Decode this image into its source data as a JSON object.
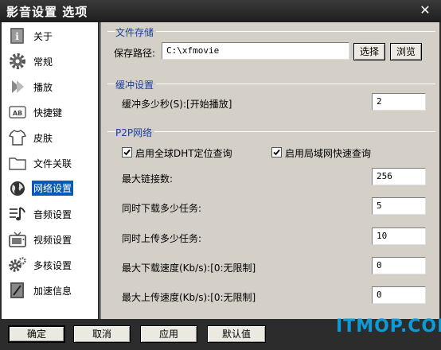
{
  "window": {
    "title": "影音设置 选项",
    "close_glyph": "✕"
  },
  "sidebar": {
    "items": [
      {
        "label": "关于",
        "icon": "info-book-icon"
      },
      {
        "label": "常规",
        "icon": "gear-icon"
      },
      {
        "label": "播放",
        "icon": "play-arrow-icon"
      },
      {
        "label": "快捷键",
        "icon": "keyboard-ab-icon"
      },
      {
        "label": "皮肤",
        "icon": "tshirt-icon"
      },
      {
        "label": "文件关联",
        "icon": "folder-icon"
      },
      {
        "label": "网络设置",
        "icon": "globe-icon",
        "active": true
      },
      {
        "label": "音频设置",
        "icon": "music-note-icon"
      },
      {
        "label": "视频设置",
        "icon": "tv-icon"
      },
      {
        "label": "多核设置",
        "icon": "multi-gear-icon"
      },
      {
        "label": "加速信息",
        "icon": "acceleration-icon"
      }
    ]
  },
  "file_storage": {
    "title": "文件存储",
    "path_label": "保存路径:",
    "path_value": "C:\\xfmovie",
    "select_button": "选择",
    "browse_button": "浏览"
  },
  "buffer": {
    "title": "缓冲设置",
    "seconds_label": "缓冲多少秒(S):[开始播放]",
    "seconds_value": "2"
  },
  "p2p": {
    "title": "P2P网络",
    "dht_label": "启用全球DHT定位查询",
    "dht_checked": true,
    "lan_label": "启用局域网快速查询",
    "lan_checked": true,
    "max_conn_label": "最大链接数:",
    "max_conn_value": "256",
    "dl_tasks_label": "同时下载多少任务:",
    "dl_tasks_value": "5",
    "ul_tasks_label": "同时上传多少任务:",
    "ul_tasks_value": "10",
    "max_dl_label": "最大下载速度(Kb/s):[0:无限制]",
    "max_dl_value": "0",
    "max_ul_label": "最大上传速度(Kb/s):[0:无限制]",
    "max_ul_value": "0"
  },
  "footer": {
    "ok": "确定",
    "cancel": "取消",
    "apply": "应用",
    "defaults": "默认值"
  },
  "watermark": "ITMOP.COM",
  "colors": {
    "accent": "#0a58b7",
    "group_title": "#1a3fa0",
    "panel": "#d4d0c8",
    "chrome": "#2c2c2c",
    "watermark": "#0e9ad6"
  }
}
